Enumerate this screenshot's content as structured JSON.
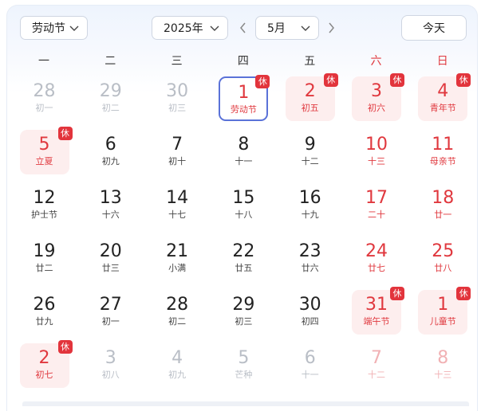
{
  "toolbar": {
    "holiday": "劳动节",
    "year": "2025年",
    "month": "5月",
    "today": "今天"
  },
  "weekdays": [
    "一",
    "二",
    "三",
    "四",
    "五",
    "六",
    "日"
  ],
  "weekend_color": "#e0383e",
  "accent_color": "#5a72d8",
  "rest_badge": "休",
  "days": [
    {
      "d": "28",
      "l": "初一",
      "type": "other"
    },
    {
      "d": "29",
      "l": "初二",
      "type": "other"
    },
    {
      "d": "30",
      "l": "初三",
      "type": "other"
    },
    {
      "d": "1",
      "l": "劳动节",
      "type": "selected",
      "badge": true
    },
    {
      "d": "2",
      "l": "初五",
      "type": "rest",
      "badge": true
    },
    {
      "d": "3",
      "l": "初六",
      "type": "rest",
      "badge": true
    },
    {
      "d": "4",
      "l": "青年节",
      "type": "rest",
      "badge": true
    },
    {
      "d": "5",
      "l": "立夏",
      "type": "rest",
      "badge": true
    },
    {
      "d": "6",
      "l": "初九",
      "type": "normal"
    },
    {
      "d": "7",
      "l": "初十",
      "type": "normal"
    },
    {
      "d": "8",
      "l": "十一",
      "type": "normal"
    },
    {
      "d": "9",
      "l": "十二",
      "type": "normal"
    },
    {
      "d": "10",
      "l": "十三",
      "type": "weekend"
    },
    {
      "d": "11",
      "l": "母亲节",
      "type": "weekend-festival"
    },
    {
      "d": "12",
      "l": "护士节",
      "type": "normal"
    },
    {
      "d": "13",
      "l": "十六",
      "type": "normal"
    },
    {
      "d": "14",
      "l": "十七",
      "type": "normal"
    },
    {
      "d": "15",
      "l": "十八",
      "type": "normal"
    },
    {
      "d": "16",
      "l": "十九",
      "type": "normal"
    },
    {
      "d": "17",
      "l": "二十",
      "type": "weekend"
    },
    {
      "d": "18",
      "l": "廿一",
      "type": "weekend"
    },
    {
      "d": "19",
      "l": "廿二",
      "type": "normal"
    },
    {
      "d": "20",
      "l": "廿三",
      "type": "normal"
    },
    {
      "d": "21",
      "l": "小满",
      "type": "normal"
    },
    {
      "d": "22",
      "l": "廿五",
      "type": "normal"
    },
    {
      "d": "23",
      "l": "廿六",
      "type": "normal"
    },
    {
      "d": "24",
      "l": "廿七",
      "type": "weekend"
    },
    {
      "d": "25",
      "l": "廿八",
      "type": "weekend"
    },
    {
      "d": "26",
      "l": "廿九",
      "type": "normal"
    },
    {
      "d": "27",
      "l": "初一",
      "type": "normal"
    },
    {
      "d": "28",
      "l": "初二",
      "type": "normal"
    },
    {
      "d": "29",
      "l": "初三",
      "type": "normal"
    },
    {
      "d": "30",
      "l": "初四",
      "type": "normal"
    },
    {
      "d": "31",
      "l": "端午节",
      "type": "rest",
      "badge": true
    },
    {
      "d": "1",
      "l": "儿童节",
      "type": "rest",
      "badge": true
    },
    {
      "d": "2",
      "l": "初七",
      "type": "rest",
      "badge": true
    },
    {
      "d": "3",
      "l": "初八",
      "type": "other"
    },
    {
      "d": "4",
      "l": "初九",
      "type": "other"
    },
    {
      "d": "5",
      "l": "芒种",
      "type": "other"
    },
    {
      "d": "6",
      "l": "十一",
      "type": "other"
    },
    {
      "d": "7",
      "l": "十二",
      "type": "other-weekend"
    },
    {
      "d": "8",
      "l": "十三",
      "type": "other-weekend"
    }
  ]
}
